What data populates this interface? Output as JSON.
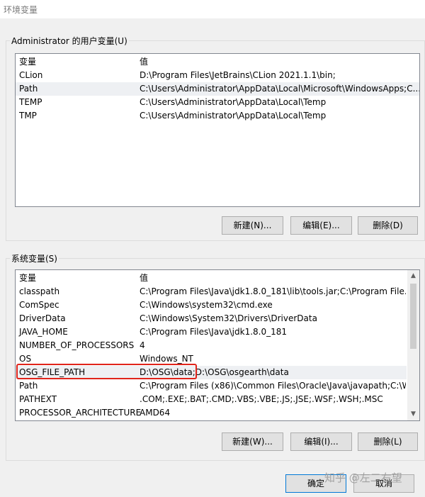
{
  "window": {
    "title": "环境变量"
  },
  "user_group": {
    "label": "Administrator 的用户变量(U)",
    "columns": {
      "name": "变量",
      "value": "值"
    },
    "rows": [
      {
        "name": "CLion",
        "value": "D:\\Program Files\\JetBrains\\CLion 2021.1.1\\bin;"
      },
      {
        "name": "Path",
        "value": "C:\\Users\\Administrator\\AppData\\Local\\Microsoft\\WindowsApps;C..."
      },
      {
        "name": "TEMP",
        "value": "C:\\Users\\Administrator\\AppData\\Local\\Temp"
      },
      {
        "name": "TMP",
        "value": "C:\\Users\\Administrator\\AppData\\Local\\Temp"
      }
    ],
    "buttons": {
      "new": "新建(N)...",
      "edit": "编辑(E)...",
      "delete": "删除(D)"
    }
  },
  "system_group": {
    "label": "系统变量(S)",
    "columns": {
      "name": "变量",
      "value": "值"
    },
    "rows": [
      {
        "name": "classpath",
        "value": "C:\\Program Files\\Java\\jdk1.8.0_181\\lib\\tools.jar;C:\\Program File..."
      },
      {
        "name": "ComSpec",
        "value": "C:\\Windows\\system32\\cmd.exe"
      },
      {
        "name": "DriverData",
        "value": "C:\\Windows\\System32\\Drivers\\DriverData"
      },
      {
        "name": "JAVA_HOME",
        "value": "C:\\Program Files\\Java\\jdk1.8.0_181"
      },
      {
        "name": "NUMBER_OF_PROCESSORS",
        "value": "4"
      },
      {
        "name": "OS",
        "value": "Windows_NT"
      },
      {
        "name": "OSG_FILE_PATH",
        "value": "D:\\OSG\\data;D:\\OSG\\osgearth\\data"
      },
      {
        "name": "Path",
        "value": "C:\\Program Files (x86)\\Common Files\\Oracle\\Java\\javapath;C:\\W..."
      },
      {
        "name": "PATHEXT",
        "value": ".COM;.EXE;.BAT;.CMD;.VBS;.VBE;.JS;.JSE;.WSF;.WSH;.MSC"
      },
      {
        "name": "PROCESSOR_ARCHITECTURE",
        "value": "AMD64"
      }
    ],
    "buttons": {
      "new": "新建(W)...",
      "edit": "编辑(I)...",
      "delete": "删除(L)"
    }
  },
  "footer": {
    "ok": "确定",
    "cancel": "取消"
  },
  "watermark": "知乎 @左二右望",
  "colors": {
    "highlight": "#e0241b",
    "selected_row": "#eef0f3",
    "default_button_border": "#0078d7"
  },
  "icons": {
    "scroll_up": "chevron-up-icon",
    "scroll_down": "chevron-down-icon"
  }
}
